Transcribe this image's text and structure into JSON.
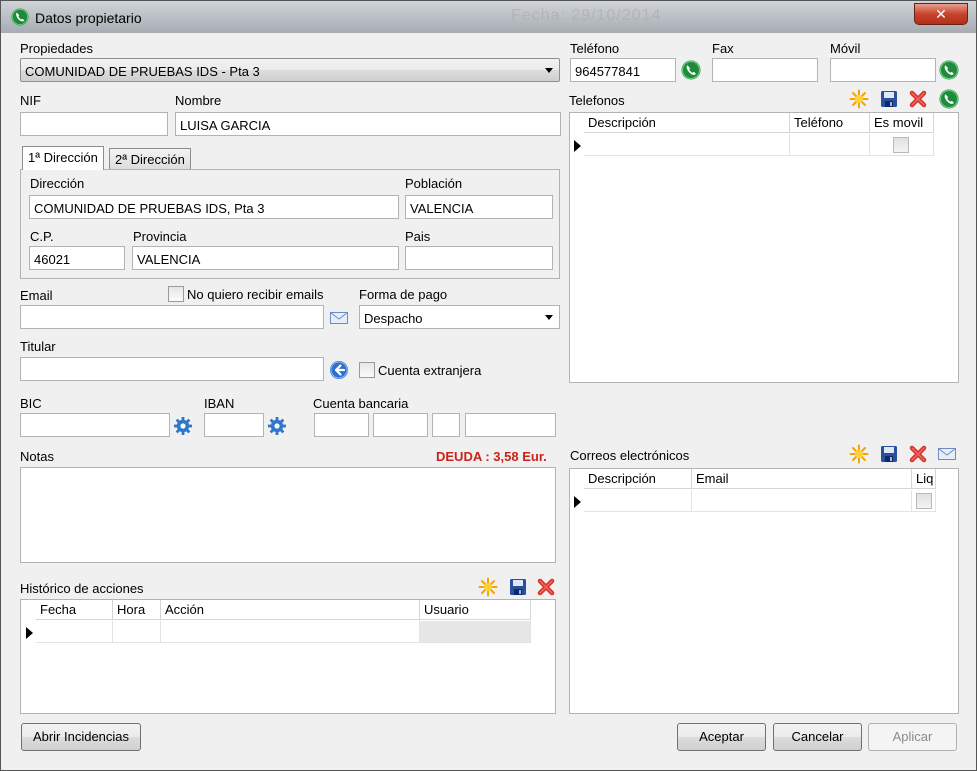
{
  "window": {
    "title": "Datos propietario",
    "background_text": "Fecha: 29/10/2014",
    "close_symbol": "✕"
  },
  "propiedades": {
    "label": "Propiedades",
    "value": "COMUNIDAD DE PRUEBAS IDS - Pta 3"
  },
  "contacto": {
    "telefono_label": "Teléfono",
    "telefono_value": "964577841",
    "fax_label": "Fax",
    "fax_value": "",
    "movil_label": "Móvil",
    "movil_value": ""
  },
  "identidad": {
    "nif_label": "NIF",
    "nif_value": "",
    "nombre_label": "Nombre",
    "nombre_value": "LUISA GARCIA"
  },
  "tabs": [
    {
      "label": "1ª Dirección",
      "active": true
    },
    {
      "label": "2ª Dirección",
      "active": false
    }
  ],
  "direccion": {
    "direccion_label": "Dirección",
    "direccion_value": "COMUNIDAD DE PRUEBAS IDS, Pta 3",
    "poblacion_label": "Población",
    "poblacion_value": "VALENCIA",
    "cp_label": "C.P.",
    "cp_value": "46021",
    "provincia_label": "Provincia",
    "provincia_value": "VALENCIA",
    "pais_label": "Pais",
    "pais_value": ""
  },
  "email": {
    "label": "Email",
    "value": "",
    "no_emails_label": "No quiero recibir emails"
  },
  "forma_pago": {
    "label": "Forma de pago",
    "value": "Despacho"
  },
  "titular": {
    "label": "Titular",
    "value": "",
    "cuenta_extranjera_label": "Cuenta extranjera"
  },
  "banco": {
    "bic_label": "BIC",
    "iban_label": "IBAN",
    "cuenta_label": "Cuenta bancaria"
  },
  "notas": {
    "label": "Notas",
    "deuda": "DEUDA : 3,58 Eur."
  },
  "telefonos": {
    "label": "Telefonos",
    "columns": [
      "Descripción",
      "Teléfono",
      "Es movil"
    ]
  },
  "correos": {
    "label": "Correos electrónicos",
    "columns": [
      "Descripción",
      "Email",
      "Liq"
    ]
  },
  "historico": {
    "label": "Histórico de acciones",
    "columns": [
      "Fecha",
      "Hora",
      "Acción",
      "Usuario"
    ]
  },
  "buttons": {
    "abrir_incidencias": "Abrir Incidencias",
    "aceptar": "Aceptar",
    "cancelar": "Cancelar",
    "aplicar": "Aplicar"
  },
  "icons": {
    "phone": "phone-icon",
    "new": "new-star-icon",
    "save": "save-disk-icon",
    "delete": "delete-x-icon",
    "mail": "mail-envelope-icon",
    "arrow": "back-arrow-icon",
    "gear": "gear-icon"
  },
  "colors": {
    "phone_green": "#1f8a3a",
    "star_orange": "#f5a400",
    "save_blue": "#2a4f9c",
    "delete_red": "#d8332a",
    "deuda_red": "#c8241b"
  }
}
